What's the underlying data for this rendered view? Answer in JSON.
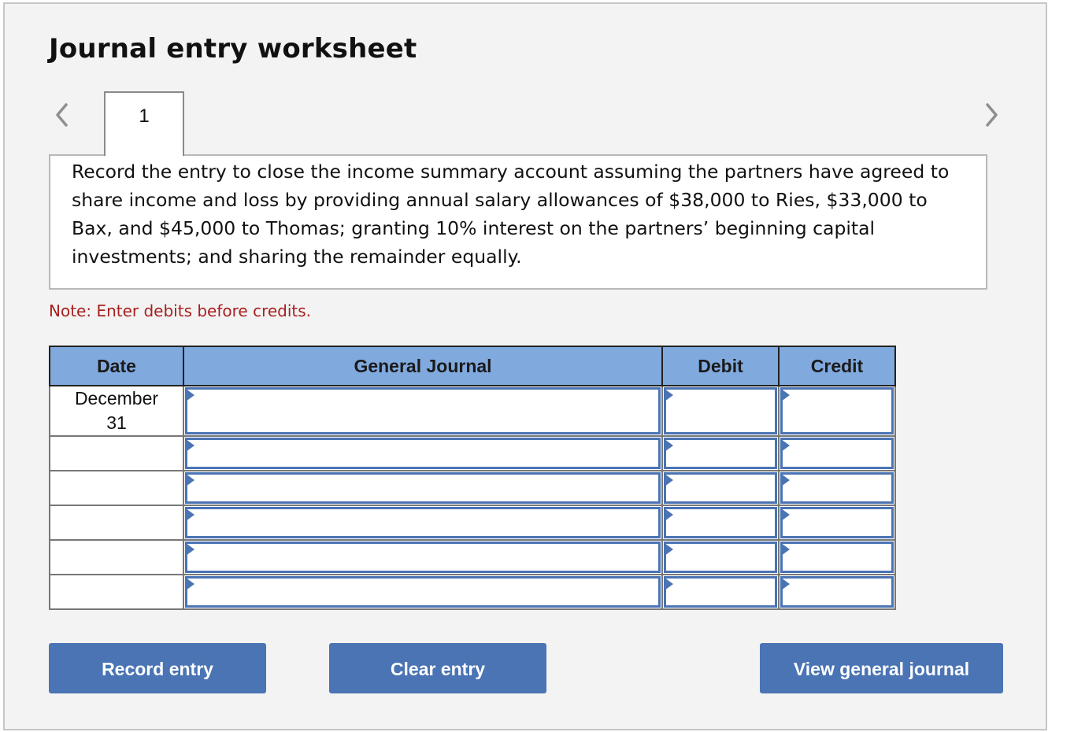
{
  "worksheet": {
    "title": "Journal entry worksheet",
    "nav": {
      "prev_icon": "chevron-left-icon",
      "next_icon": "chevron-right-icon"
    },
    "tabs": [
      {
        "label": "1",
        "active": true
      }
    ],
    "question": "Record the entry to close the income summary account assuming the partners have agreed to share income and loss by providing annual salary allowances of $38,000 to Ries, $33,000 to Bax, and $45,000 to Thomas; granting 10% interest on the partners’ beginning capital investments; and sharing the remainder equally.",
    "note": "Note: Enter debits before credits."
  },
  "journal": {
    "headers": {
      "date": "Date",
      "general_journal": "General Journal",
      "debit": "Debit",
      "credit": "Credit"
    },
    "rows": [
      {
        "date": "December 31",
        "account": "",
        "debit": "",
        "credit": ""
      },
      {
        "date": "",
        "account": "",
        "debit": "",
        "credit": ""
      },
      {
        "date": "",
        "account": "",
        "debit": "",
        "credit": ""
      },
      {
        "date": "",
        "account": "",
        "debit": "",
        "credit": ""
      },
      {
        "date": "",
        "account": "",
        "debit": "",
        "credit": ""
      },
      {
        "date": "",
        "account": "",
        "debit": "",
        "credit": ""
      }
    ]
  },
  "buttons": {
    "record": "Record entry",
    "clear": "Clear entry",
    "view": "View general journal"
  },
  "colors": {
    "header_bg": "#80a9de",
    "button_bg": "#4a74b4",
    "input_border": "#4a74b4",
    "note_text": "#a82020",
    "panel_bg": "#f3f3f3"
  }
}
